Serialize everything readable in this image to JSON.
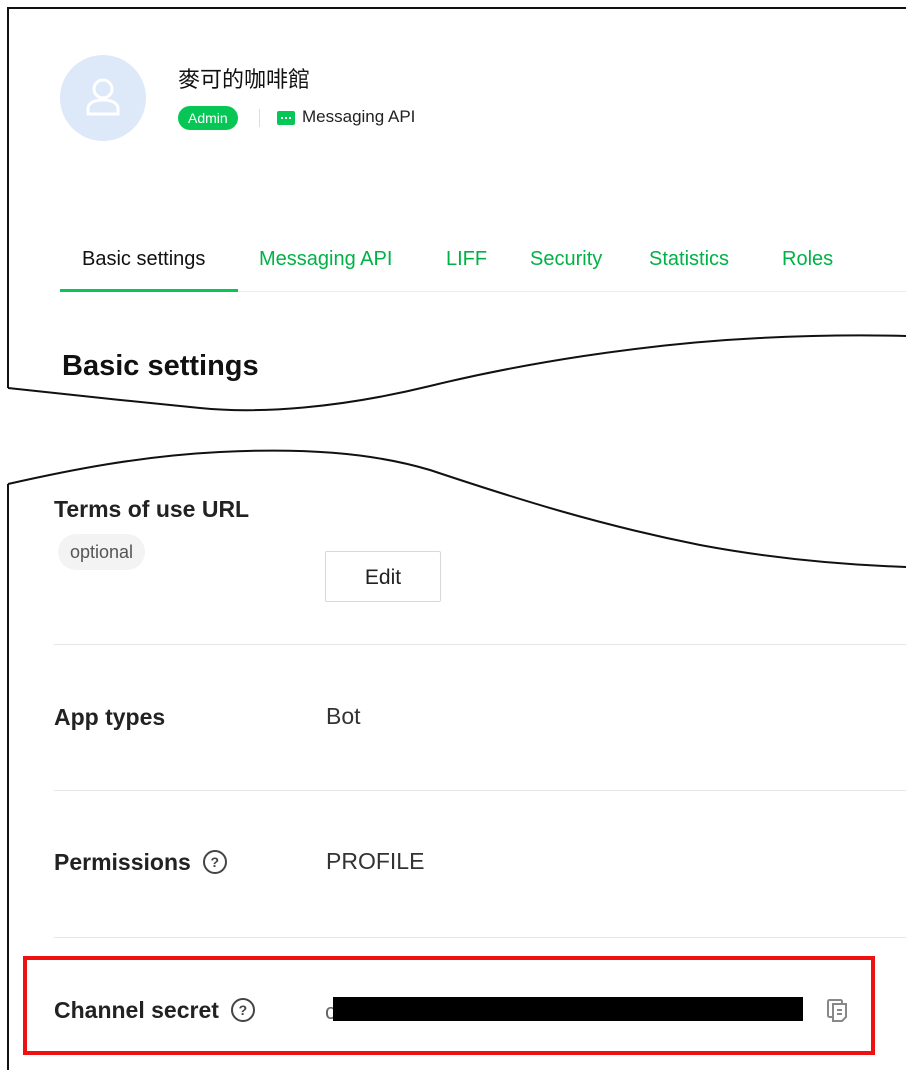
{
  "channel": {
    "name": "麥可的咖啡館",
    "role_badge": "Admin",
    "type": "Messaging API"
  },
  "tabs": [
    {
      "label": "Basic settings",
      "active": true
    },
    {
      "label": "Messaging API",
      "active": false
    },
    {
      "label": "LIFF",
      "active": false
    },
    {
      "label": "Security",
      "active": false
    },
    {
      "label": "Statistics",
      "active": false
    },
    {
      "label": "Roles",
      "active": false
    }
  ],
  "section_title": "Basic settings",
  "rows": {
    "terms": {
      "label": "Terms of use URL",
      "badge": "optional",
      "button": "Edit"
    },
    "app_types": {
      "label": "App types",
      "value": "Bot"
    },
    "permissions": {
      "label": "Permissions",
      "help": "?",
      "value": "PROFILE"
    },
    "channel_secret": {
      "label": "Channel secret",
      "help": "?",
      "value_visible_prefix": "c"
    }
  },
  "colors": {
    "accent_green": "#06c755",
    "tab_green": "#00b246",
    "highlight_red": "#ee1111",
    "avatar_bg": "#dde8f8"
  },
  "icons": {
    "avatar": "user-outline-icon",
    "channel_type": "message-bubble-icon",
    "help": "question-circle-icon",
    "copy": "copy-icon"
  }
}
